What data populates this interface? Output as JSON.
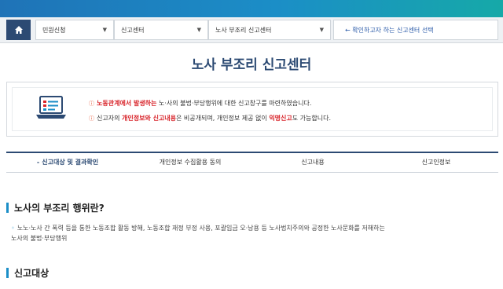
{
  "nav": {
    "home_label": "home",
    "select1": "민원신청",
    "select2": "신고센터",
    "select3": "노사 부조리 신고센터",
    "guide_link": "← 확인하고자 하는 신고센터 선택"
  },
  "page_title": "노사 부조리 신고센터",
  "notice": {
    "line1_highlight": "노동관계에서 발생하는",
    "line1_rest": " 노·사의 불법·부당행위에 대한 신고창구를 마련하였습니다.",
    "line2_pre": "신고자의 ",
    "line2_hl1": "개인정보와 신고내용",
    "line2_mid": "은 비공개되며, 개인정보 제공 없이 ",
    "line2_hl2": "익명신고",
    "line2_post": "도 가능합니다."
  },
  "tabs": [
    {
      "label": "신고대상 및 결과확인",
      "active": true
    },
    {
      "label": "개인정보 수집활용 동의",
      "active": false
    },
    {
      "label": "신고내용",
      "active": false
    },
    {
      "label": "신고인정보",
      "active": false
    }
  ],
  "section1": {
    "heading": "노사의 부조리 행위란?",
    "line1": "노노·노사 간 폭력 등을 통한 노동조합 활동 방해, 노동조합 재정 부정 사용, 포괄임금 오·남용 등 노사법치주의와 공정한 노사문화를 저해하는",
    "line2": "노사의 불법·부당행위"
  },
  "section2": {
    "heading": "신고대상"
  },
  "colors": {
    "primary": "#2c4a73",
    "accent": "#1b8ec7",
    "highlight_red": "#d8242a"
  },
  "icons": [
    "home-icon",
    "chevron-down-icon",
    "laptop-form-icon",
    "info-icon"
  ]
}
